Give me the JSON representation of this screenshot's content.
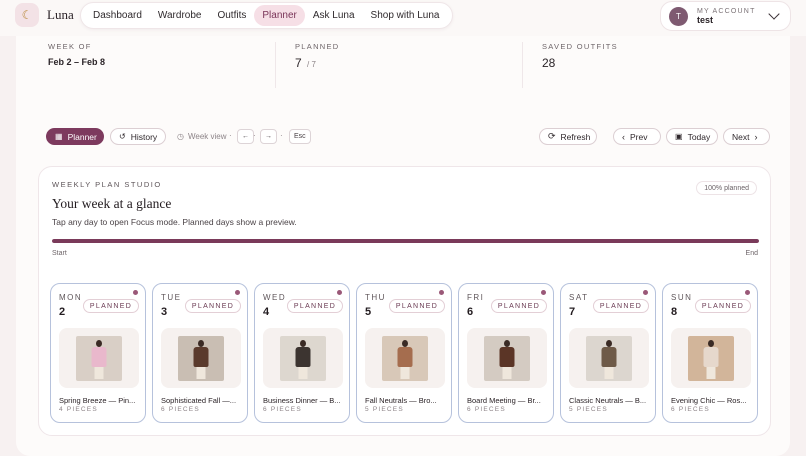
{
  "brand": {
    "name": "Luna",
    "logo_icon": "moon-icon"
  },
  "nav": {
    "items": [
      "Dashboard",
      "Wardrobe",
      "Outfits",
      "Planner",
      "Ask Luna",
      "Shop with Luna"
    ],
    "active": "Planner"
  },
  "account": {
    "label": "MY ACCOUNT",
    "name": "test",
    "initial": "T"
  },
  "stats": {
    "week_of_label": "WEEK OF",
    "week_of_value": "Feb 2 – Feb 8",
    "planned_label": "PLANNED",
    "planned_value": "7",
    "planned_total": "/ 7",
    "saved_label": "SAVED OUTFITS",
    "saved_value": "28"
  },
  "toolbar": {
    "planner": "Planner",
    "history": "History",
    "week_view": "Week view",
    "key_left": "←",
    "key_right": "→",
    "key_esc": "Esc",
    "refresh": "Refresh",
    "prev": "Prev",
    "today": "Today",
    "next": "Next"
  },
  "studio": {
    "kicker": "WEEKLY PLAN STUDIO",
    "title": "Your week at a glance",
    "subtitle": "Tap any day to open Focus mode. Planned days show a preview.",
    "badge": "100% planned",
    "progress_pct": 100,
    "start": "Start",
    "end": "End"
  },
  "days": [
    {
      "dow": "MON",
      "num": "2",
      "status": "PLANNED",
      "outfit": "Spring Breeze — Pin...",
      "pieces": "4 PIECES",
      "bg": "#d9cfc6",
      "coat": "#e9b8cc"
    },
    {
      "dow": "TUE",
      "num": "3",
      "status": "PLANNED",
      "outfit": "Sophisticated Fall —...",
      "pieces": "6 PIECES",
      "bg": "#c9beb3",
      "coat": "#5a3a2c"
    },
    {
      "dow": "WED",
      "num": "4",
      "status": "PLANNED",
      "outfit": "Business Dinner — B...",
      "pieces": "6 PIECES",
      "bg": "#ddd7cf",
      "coat": "#3c3430"
    },
    {
      "dow": "THU",
      "num": "5",
      "status": "PLANNED",
      "outfit": "Fall Neutrals — Bro...",
      "pieces": "5 PIECES",
      "bg": "#d8c8b8",
      "coat": "#a56d4e"
    },
    {
      "dow": "FRI",
      "num": "6",
      "status": "PLANNED",
      "outfit": "Board Meeting — Br...",
      "pieces": "6 PIECES",
      "bg": "#d4cbc2",
      "coat": "#5b3526"
    },
    {
      "dow": "SAT",
      "num": "7",
      "status": "PLANNED",
      "outfit": "Classic Neutrals — B...",
      "pieces": "5 PIECES",
      "bg": "#dcd6cf",
      "coat": "#6e5a48"
    },
    {
      "dow": "SUN",
      "num": "8",
      "status": "PLANNED",
      "outfit": "Evening Chic — Ros...",
      "pieces": "6 PIECES",
      "bg": "#d2b59a",
      "coat": "#e6d8cc"
    }
  ]
}
